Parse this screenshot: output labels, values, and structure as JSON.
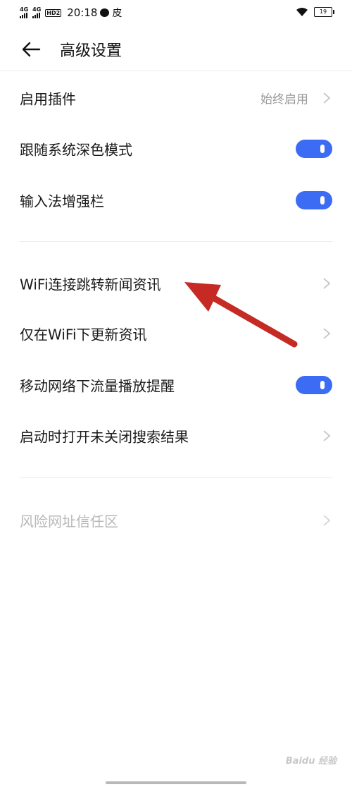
{
  "status_bar": {
    "net1": "4G",
    "net2": "4G",
    "hd": "HD2",
    "time": "20:18",
    "extra_icon": "皮",
    "battery": "19"
  },
  "header": {
    "title": "高级设置"
  },
  "settings": {
    "plugins": {
      "label": "启用插件",
      "value": "始终启用"
    },
    "dark_mode": {
      "label": "跟随系统深色模式",
      "on": true
    },
    "ime_bar": {
      "label": "输入法增强栏",
      "on": true
    },
    "wifi_news": {
      "label": "WiFi连接跳转新闻资讯"
    },
    "wifi_update": {
      "label": "仅在WiFi下更新资讯"
    },
    "mobile_data_alert": {
      "label": "移动网络下流量播放提醒",
      "on": true
    },
    "restore_search": {
      "label": "启动时打开未关闭搜索结果"
    },
    "risky_sites": {
      "label": "风险网址信任区"
    }
  },
  "colors": {
    "accent": "#3b6cf3",
    "annotation_arrow": "#c62a24"
  },
  "watermark": "Baidu 经验"
}
